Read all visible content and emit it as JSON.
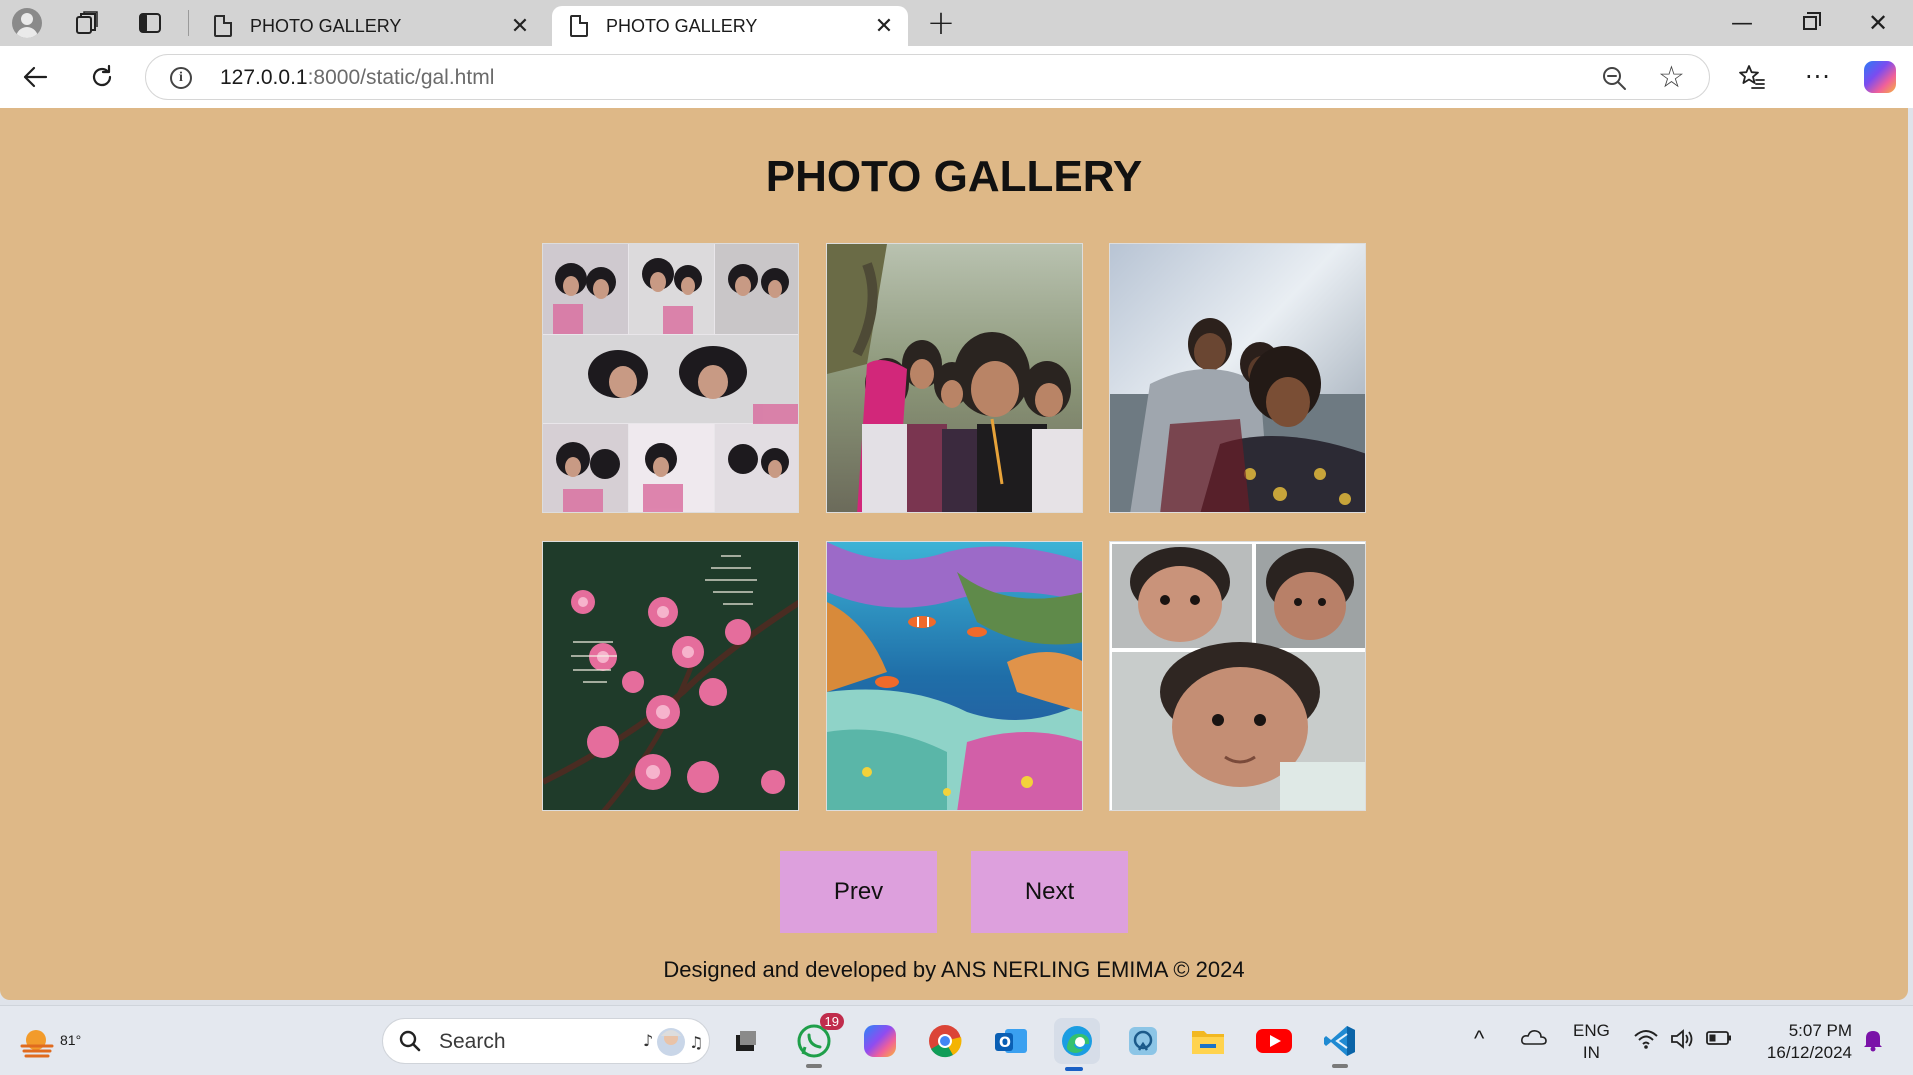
{
  "browser": {
    "tabs": [
      {
        "title": "PHOTO GALLERY",
        "active": false
      },
      {
        "title": "PHOTO GALLERY",
        "active": true
      }
    ],
    "address": {
      "host": "127.0.0.1",
      "rest": ":8000/static/gal.html"
    },
    "icons": [
      "profile-icon",
      "workspaces-icon",
      "vertical-tabs-icon",
      "new-tab-icon",
      "back-icon",
      "reload-icon",
      "site-info-icon",
      "zoom-out-icon",
      "favorite-star-icon",
      "favorites-icon",
      "more-icon",
      "copilot-icon"
    ]
  },
  "page": {
    "title": "PHOTO GALLERY",
    "photos": [
      {
        "name": "collage-of-two-girls"
      },
      {
        "name": "group-selfie-of-girls"
      },
      {
        "name": "family-selfie-at-beach"
      },
      {
        "name": "pink-blossoms-with-verse"
      },
      {
        "name": "coral-reef"
      },
      {
        "name": "baby-collage"
      }
    ],
    "buttons": {
      "prev": "Prev",
      "next": "Next"
    },
    "footer": "Designed and developed by ANS NERLING EMIMA © 2024"
  },
  "taskbar": {
    "weather_temp": "81°",
    "search_placeholder": "Search",
    "whatsapp_badge": "19",
    "lang_line1": "ENG",
    "lang_line2": "IN",
    "time": "5:07 PM",
    "date": "16/12/2024",
    "colors": {
      "accent": "#1a5fc4",
      "page_bg": "#deb887",
      "button_bg": "#dda0dd"
    }
  }
}
